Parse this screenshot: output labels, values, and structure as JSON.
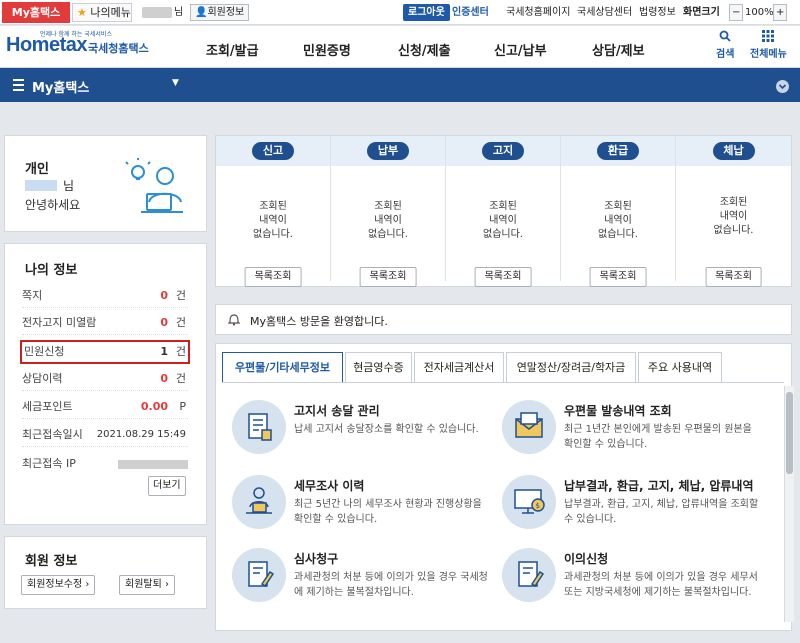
{
  "topbar": {
    "my_tab": "My홈택스",
    "fav_tab": "나의메뉴",
    "user_suffix": "님",
    "member_info": "회원정보",
    "logout": "로그아웃",
    "cert_center": "인증센터",
    "nts_home": "국세청홈페이지",
    "nts_counsel": "국세상담센터",
    "law_info": "법령정보",
    "screen_size": "화면크기",
    "zoom_minus": "−",
    "zoom_value": "100%",
    "zoom_plus": "+"
  },
  "gnb": {
    "logo_small": "언제나 함께 하는 국세서비스",
    "logo_main": "Hometax",
    "logo_sub": "국세청홈택스",
    "menu": [
      "조회/발급",
      "민원증명",
      "신청/제출",
      "신고/납부",
      "상담/제보"
    ],
    "search": "검색",
    "all_menu": "전체메뉴"
  },
  "mybar": {
    "title": "My홈택스"
  },
  "profile": {
    "type": "개인",
    "name_suffix": "님",
    "greeting": "안녕하세요"
  },
  "myinfo": {
    "title": "나의 정보",
    "rows": [
      {
        "label": "쪽지",
        "value": "0",
        "unit": "건"
      },
      {
        "label": "전자고지 미열람",
        "value": "0",
        "unit": "건"
      },
      {
        "label": "민원신청",
        "value": "1",
        "unit": "건"
      },
      {
        "label": "상담이력",
        "value": "0",
        "unit": "건"
      },
      {
        "label": "세금포인트",
        "value": "0.00",
        "unit": "P"
      },
      {
        "label": "최근접속일시",
        "value": "2021.08.29 15:49",
        "unit": ""
      },
      {
        "label": "최근접속 IP",
        "value": "",
        "unit": ""
      }
    ],
    "more": "더보기"
  },
  "member": {
    "title": "회원 정보",
    "edit": "회원정보수정",
    "withdraw": "회원탈퇴"
  },
  "status": {
    "columns": [
      {
        "label": "신고",
        "line1": "조회된",
        "line2": "내역이",
        "line3": "없습니다.",
        "button": "목록조회"
      },
      {
        "label": "납부",
        "line1": "조회된",
        "line2": "내역이",
        "line3": "없습니다.",
        "button": "목록조회"
      },
      {
        "label": "고지",
        "line1": "조회된",
        "line2": "내역이",
        "line3": "없습니다.",
        "button": "목록조회"
      },
      {
        "label": "환급",
        "line1": "조회된",
        "line2": "내역이",
        "line3": "없습니다.",
        "button": "목록조회"
      },
      {
        "label": "체납",
        "line1": "조회된",
        "line2": "내역이",
        "line3": "없습니다.",
        "button": "목록조회"
      }
    ]
  },
  "notice": {
    "text": "My홈택스 방문을 환영합니다."
  },
  "tabs": [
    "우편물/기타세무정보",
    "현금영수증",
    "전자세금계산서",
    "연말정산/장려금/학자금",
    "주요 사용내역"
  ],
  "services": [
    {
      "title": "고지서 송달 관리",
      "desc": "납세 고지서 송달장소를 확인할 수 있습니다.",
      "icon": "document-icon"
    },
    {
      "title": "우편물 발송내역 조회",
      "desc": "최근 1년간 본인에게 발송된 우편물의 원본을 확인할 수 있습니다.",
      "icon": "envelope-icon"
    },
    {
      "title": "세무조사 이력",
      "desc": "최근 5년간 나의 세무조사 현황과 진행상황을 확인할 수 있습니다.",
      "icon": "person-desk-icon"
    },
    {
      "title": "납부결과, 환급, 고지, 체납, 압류내역",
      "desc": "납부결과, 환급, 고지, 체납, 압류내역을 조회할 수 있습니다.",
      "icon": "monitor-coin-icon"
    },
    {
      "title": "심사청구",
      "desc": "과세관청의 처분 등에 이의가 있을 경우 국세청에 제기하는 불복절차입니다.",
      "icon": "pencil-doc-icon"
    },
    {
      "title": "이의신청",
      "desc": "과세관청의 처분 등에 이의가 있을 경우 세무서 또는 지방국세청에 제기하는 불복절차입니다.",
      "icon": "pencil-doc-icon"
    }
  ],
  "colors": {
    "brand_blue": "#1f4f8f",
    "accent_red": "#e23b3b",
    "light_blue": "#e6eef8"
  }
}
